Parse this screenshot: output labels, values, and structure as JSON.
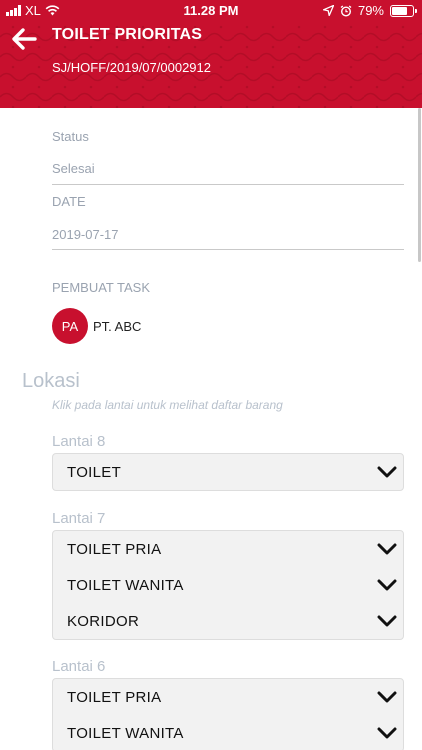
{
  "status_bar": {
    "carrier": "XL",
    "time": "11.28 PM",
    "battery_percent": "79%",
    "battery_level": 0.79,
    "icons": [
      "signal-icon",
      "wifi-icon",
      "location-arrow-icon",
      "alarm-icon",
      "battery-icon"
    ]
  },
  "header": {
    "title": "TOILET PRIORITAS",
    "subtitle": "SJ/HOFF/2019/07/0002912",
    "back_icon": "arrow-left-icon",
    "color": "#c8102e"
  },
  "fields": {
    "status_label": "Status",
    "status_value": "Selesai",
    "date_label": "DATE",
    "date_value": "2019-07-17",
    "creator_label": "PEMBUAT TASK",
    "creator_initials": "PA",
    "creator_name": "PT. ABC"
  },
  "lokasi": {
    "title": "Lokasi",
    "hint": "Klik pada lantai untuk melihat daftar barang",
    "floors": [
      {
        "label": "Lantai 8",
        "items": [
          "TOILET"
        ]
      },
      {
        "label": "Lantai 7",
        "items": [
          "TOILET PRIA",
          "TOILET WANITA",
          "KORIDOR"
        ]
      },
      {
        "label": "Lantai 6",
        "items": [
          "TOILET PRIA",
          "TOILET WANITA"
        ]
      }
    ],
    "item_icon": "chevron-down-icon"
  }
}
